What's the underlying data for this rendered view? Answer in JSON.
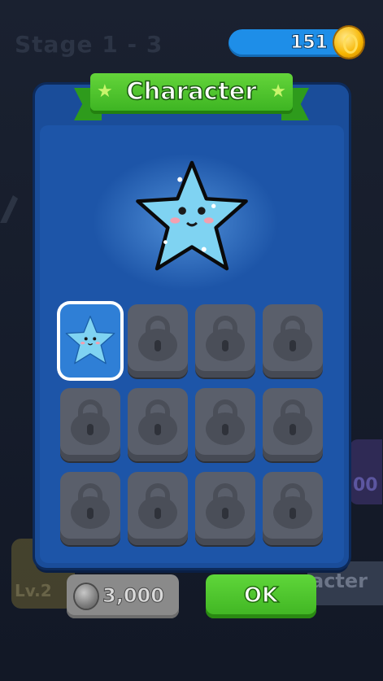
{
  "background": {
    "stage_label": "Stage 1 - 3",
    "level_label": "Lv.2",
    "purple_fragment": "00",
    "character_fragment": "acter"
  },
  "currency": {
    "coins": "151",
    "icon": "gold-coin-icon"
  },
  "dialog": {
    "title": "Character",
    "preview_icon": "blue-star-character-icon",
    "slots": [
      {
        "state": "selected",
        "icon": "blue-star-character-icon"
      },
      {
        "state": "locked",
        "icon": "lock-icon"
      },
      {
        "state": "locked",
        "icon": "lock-icon"
      },
      {
        "state": "locked",
        "icon": "lock-icon"
      },
      {
        "state": "locked",
        "icon": "lock-icon"
      },
      {
        "state": "locked",
        "icon": "lock-icon"
      },
      {
        "state": "locked",
        "icon": "lock-icon"
      },
      {
        "state": "locked",
        "icon": "lock-icon"
      },
      {
        "state": "locked",
        "icon": "lock-icon"
      },
      {
        "state": "locked",
        "icon": "lock-icon"
      },
      {
        "state": "locked",
        "icon": "lock-icon"
      },
      {
        "state": "locked",
        "icon": "lock-icon"
      }
    ],
    "price": {
      "value": "3,000",
      "icon": "silver-coin-icon"
    },
    "ok_label": "OK"
  },
  "colors": {
    "panel": "#1a4d9a",
    "ribbon": "#4cc22a",
    "ok_button": "#4ec52e",
    "coin_bar": "#1e8ee8",
    "star": "#7fd3f2"
  }
}
